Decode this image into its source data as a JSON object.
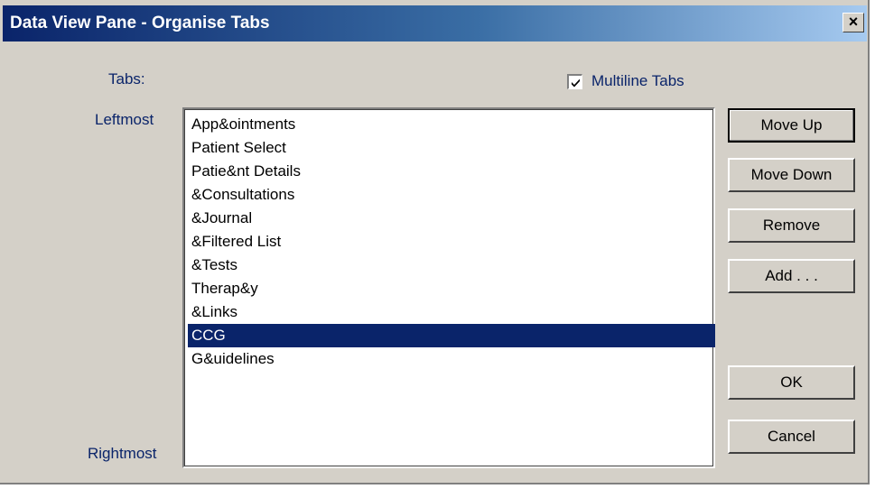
{
  "window": {
    "title": "Data View Pane - Organise Tabs",
    "close_glyph": "×"
  },
  "labels": {
    "tabs": "Tabs:",
    "leftmost": "Leftmost",
    "rightmost": "Rightmost"
  },
  "multiline": {
    "label": "Multiline Tabs",
    "checked": true
  },
  "list": {
    "items": [
      "App&ointments",
      "Patient Select",
      "Patie&nt Details",
      "&Consultations",
      "&Journal",
      "&Filtered List",
      "&Tests",
      "Therap&y",
      "&Links",
      "CCG",
      "G&uidelines"
    ],
    "selected_index": 9
  },
  "buttons": {
    "move_up": "Move Up",
    "move_down": "Move Down",
    "remove": "Remove",
    "add": "Add . . .",
    "ok": "OK",
    "cancel": "Cancel"
  },
  "colors": {
    "selection": "#0a246a",
    "label_text": "#0a246a",
    "dialog_face": "#d4d0c8"
  }
}
